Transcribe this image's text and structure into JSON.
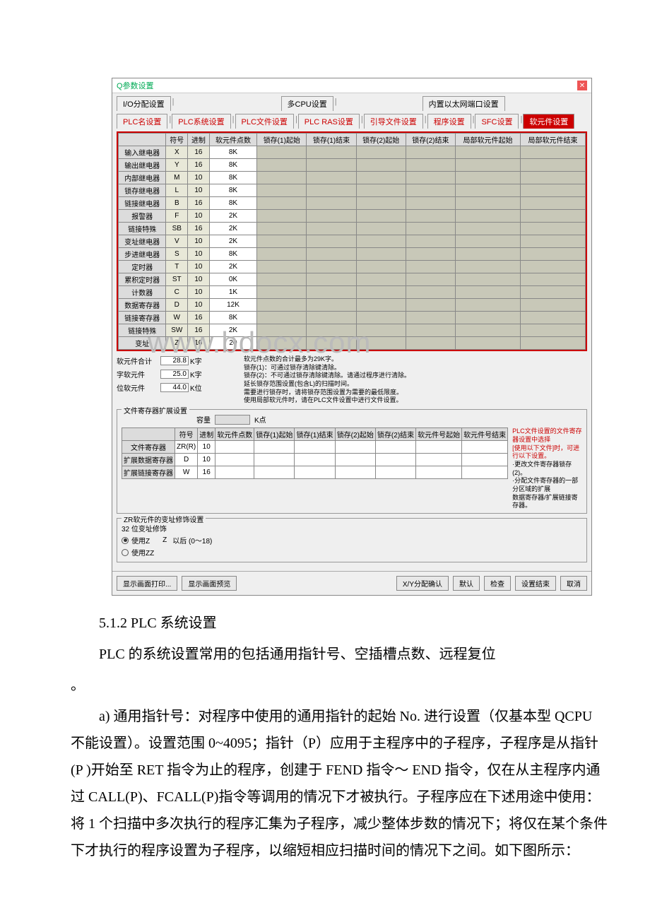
{
  "dialog": {
    "title": "Q参数设置",
    "tabs_row1": [
      "I/O分配设置",
      "多CPU设置",
      "内置以太网端口设置"
    ],
    "tabs_row2": [
      "PLC名设置",
      "PLC系统设置",
      "PLC文件设置",
      "PLC RAS设置",
      "引导文件设置",
      "程序设置",
      "SFC设置",
      "软元件设置"
    ],
    "headers": [
      "",
      "符号",
      "进制",
      "软元件点数",
      "锁存(1)起始",
      "锁存(1)结束",
      "锁存(2)起始",
      "锁存(2)结束",
      "局部软元件起始",
      "局部软元件结束"
    ],
    "rows": [
      {
        "label": "输入继电器",
        "sym": "X",
        "base": "16",
        "pts": "8K"
      },
      {
        "label": "输出继电器",
        "sym": "Y",
        "base": "16",
        "pts": "8K"
      },
      {
        "label": "内部继电器",
        "sym": "M",
        "base": "10",
        "pts": "8K"
      },
      {
        "label": "锁存继电器",
        "sym": "L",
        "base": "10",
        "pts": "8K"
      },
      {
        "label": "链接继电器",
        "sym": "B",
        "base": "16",
        "pts": "8K"
      },
      {
        "label": "报警器",
        "sym": "F",
        "base": "10",
        "pts": "2K"
      },
      {
        "label": "链接特殊",
        "sym": "SB",
        "base": "16",
        "pts": "2K"
      },
      {
        "label": "变址继电器",
        "sym": "V",
        "base": "10",
        "pts": "2K"
      },
      {
        "label": "步进继电器",
        "sym": "S",
        "base": "10",
        "pts": "8K"
      },
      {
        "label": "定时器",
        "sym": "T",
        "base": "10",
        "pts": "2K"
      },
      {
        "label": "累积定时器",
        "sym": "ST",
        "base": "10",
        "pts": "0K"
      },
      {
        "label": "计数器",
        "sym": "C",
        "base": "10",
        "pts": "1K"
      },
      {
        "label": "数据寄存器",
        "sym": "D",
        "base": "10",
        "pts": "12K"
      },
      {
        "label": "链接寄存器",
        "sym": "W",
        "base": "16",
        "pts": "8K"
      },
      {
        "label": "链接特殊",
        "sym": "SW",
        "base": "16",
        "pts": "2K"
      },
      {
        "label": "变址",
        "sym": "Z",
        "base": "10",
        "pts": "20"
      }
    ],
    "summary": {
      "total_label": "软元件合计",
      "total_val": "28.8",
      "total_unit": "K字",
      "word_label": "字软元件",
      "word_val": "25.0",
      "word_unit": "K字",
      "bit_label": "位软元件",
      "bit_val": "44.0",
      "bit_unit": "K位"
    },
    "notes": [
      "软元件点数的合计最多为29K字。",
      "锁存(1)：可通过锁存清除键清除。",
      "锁存(2)：不可通过锁存清除键清除。请通过程序进行清除。",
      "延长锁存范围设置(包含L)的扫描时间。",
      "需要进行锁存时，请将锁存范围设置为需要的最低限度。",
      "使用局部软元件时，请在PLC文件设置中进行文件设置。"
    ],
    "file_group": {
      "legend": "文件寄存器扩展设置",
      "cap_label": "容量",
      "cap_unit": "K点",
      "headers": [
        "",
        "符号",
        "进制",
        "软元件点数",
        "锁存(1)起始",
        "锁存(1)结束",
        "锁存(2)起始",
        "锁存(2)结束",
        "软元件号起始",
        "软元件号结束"
      ],
      "rows": [
        {
          "label": "文件寄存器",
          "sym": "ZR(R)",
          "base": "10"
        },
        {
          "label": "扩展数据寄存器",
          "sym": "D",
          "base": "10"
        },
        {
          "label": "扩展链接寄存器",
          "sym": "W",
          "base": "16"
        }
      ],
      "side_notes": [
        "PLC文件设置的文件寄存器设置中选择",
        "[使用以下文件]时，可进行以下设置。",
        "·更改文件寄存器锁存(2)。",
        "·分配文件寄存器的一部分区域的扩展",
        "数据寄存器/扩展链接寄存器。"
      ]
    },
    "zr_group": {
      "legend": "ZR软元件的变址修饰设置",
      "sub": "32 位变址修饰",
      "opt1": "使用Z",
      "z_label": "Z",
      "z_after": "以后 (0～18)",
      "opt2": "使用ZZ"
    },
    "buttons": {
      "print": "显示画面打印...",
      "preview": "显示画面预览",
      "xy": "X/Y分配确认",
      "default": "默认",
      "check": "检查",
      "end": "设置结束",
      "cancel": "取消"
    }
  },
  "watermark": "www.bdocx.com",
  "body": {
    "h": "5.1.2 PLC 系统设置",
    "p1": "PLC 的系统设置常用的包括通用指针号、空插槽点数、远程复位",
    "p1b": "。",
    "p2": "a) 通用指针号：对程序中使用的通用指针的起始 No. 进行设置（仅基本型 QCPU 不能设置）。设置范围 0~4095；指针（P）应用于主程序中的子程序，子程序是从指针 (P )开始至 RET 指令为止的程序，创建于 FEND 指令～ END 指令，仅在从主程序内通过 CALL(P)、FCALL(P)指令等调用的情况下才被执行。子程序应在下述用途中使用：将 1 个扫描中多次执行的程序汇集为子程序，减少整体步数的情况下；将仅在某个条件下才执行的程序设置为子程序，以缩短相应扫描时间的情况下之间。如下图所示："
  }
}
